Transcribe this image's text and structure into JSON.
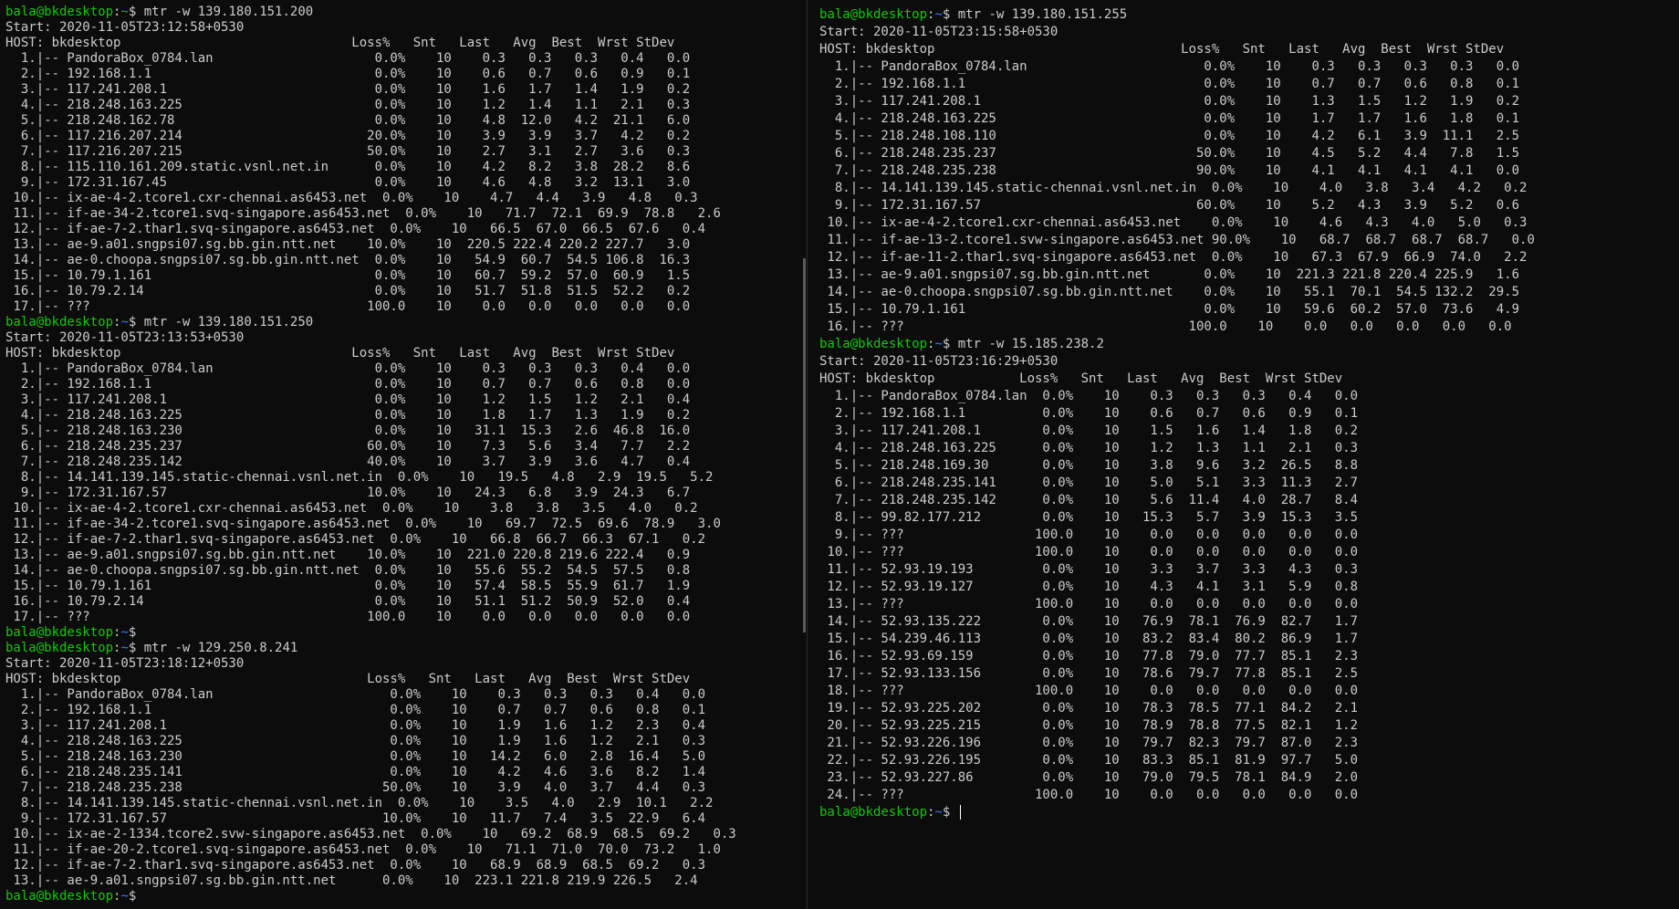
{
  "prompt": {
    "user": "bala@bkdesktop",
    "sep": ":",
    "path": "~",
    "sym": "$"
  },
  "cursor": " ",
  "left": {
    "lines": [
      {
        "t": "prompt",
        "cmd": " mtr -w 139.180.151.200"
      },
      {
        "t": "text",
        "text": "Start: 2020-11-05T23:12:58+0530"
      },
      {
        "t": "text",
        "text": "HOST: bkdesktop                              Loss%   Snt   Last   Avg  Best  Wrst StDev"
      },
      {
        "t": "text",
        "text": "  1.|-- PandoraBox_0784.lan                     0.0%    10    0.3   0.3   0.3   0.4   0.0"
      },
      {
        "t": "text",
        "text": "  2.|-- 192.168.1.1                             0.0%    10    0.6   0.7   0.6   0.9   0.1"
      },
      {
        "t": "text",
        "text": "  3.|-- 117.241.208.1                           0.0%    10    1.6   1.7   1.4   1.9   0.2"
      },
      {
        "t": "text",
        "text": "  4.|-- 218.248.163.225                         0.0%    10    1.2   1.4   1.1   2.1   0.3"
      },
      {
        "t": "text",
        "text": "  5.|-- 218.248.162.78                          0.0%    10    4.8  12.0   4.2  21.1   6.0"
      },
      {
        "t": "text",
        "text": "  6.|-- 117.216.207.214                        20.0%    10    3.9   3.9   3.7   4.2   0.2"
      },
      {
        "t": "text",
        "text": "  7.|-- 117.216.207.215                        50.0%    10    2.7   3.1   2.7   3.6   0.3"
      },
      {
        "t": "text",
        "text": "  8.|-- 115.110.161.209.static.vsnl.net.in      0.0%    10    4.2   8.2   3.8  28.2   8.6"
      },
      {
        "t": "text",
        "text": "  9.|-- 172.31.167.45                           0.0%    10    4.6   4.8   3.2  13.1   3.0"
      },
      {
        "t": "text",
        "text": " 10.|-- ix-ae-4-2.tcore1.cxr-chennai.as6453.net  0.0%    10    4.7   4.4   3.9   4.8   0.3"
      },
      {
        "t": "text",
        "text": " 11.|-- if-ae-34-2.tcore1.svq-singapore.as6453.net  0.0%    10   71.7  72.1  69.9  78.8   2.6"
      },
      {
        "t": "text",
        "text": " 12.|-- if-ae-7-2.thar1.svq-singapore.as6453.net  0.0%    10   66.5  67.0  66.5  67.6   0.4"
      },
      {
        "t": "text",
        "text": " 13.|-- ae-9.a01.sngpsi07.sg.bb.gin.ntt.net    10.0%    10  220.5 222.4 220.2 227.7   3.0"
      },
      {
        "t": "text",
        "text": " 14.|-- ae-0.choopa.sngpsi07.sg.bb.gin.ntt.net  0.0%    10   54.9  60.7  54.5 106.8  16.3"
      },
      {
        "t": "text",
        "text": " 15.|-- 10.79.1.161                             0.0%    10   60.7  59.2  57.0  60.9   1.5"
      },
      {
        "t": "text",
        "text": " 16.|-- 10.79.2.14                              0.0%    10   51.7  51.8  51.5  52.2   0.2"
      },
      {
        "t": "text",
        "text": " 17.|-- ???                                    100.0    10    0.0   0.0   0.0   0.0   0.0"
      },
      {
        "t": "prompt",
        "cmd": " mtr -w 139.180.151.250"
      },
      {
        "t": "text",
        "text": "Start: 2020-11-05T23:13:53+0530"
      },
      {
        "t": "text",
        "text": "HOST: bkdesktop                              Loss%   Snt   Last   Avg  Best  Wrst StDev"
      },
      {
        "t": "text",
        "text": "  1.|-- PandoraBox_0784.lan                     0.0%    10    0.3   0.3   0.3   0.4   0.0"
      },
      {
        "t": "text",
        "text": "  2.|-- 192.168.1.1                             0.0%    10    0.7   0.7   0.6   0.8   0.0"
      },
      {
        "t": "text",
        "text": "  3.|-- 117.241.208.1                           0.0%    10    1.2   1.5   1.2   2.1   0.4"
      },
      {
        "t": "text",
        "text": "  4.|-- 218.248.163.225                         0.0%    10    1.8   1.7   1.3   1.9   0.2"
      },
      {
        "t": "text",
        "text": "  5.|-- 218.248.163.230                         0.0%    10   31.1  15.3   2.6  46.8  16.0"
      },
      {
        "t": "text",
        "text": "  6.|-- 218.248.235.237                        60.0%    10    7.3   5.6   3.4   7.7   2.2"
      },
      {
        "t": "text",
        "text": "  7.|-- 218.248.235.142                        40.0%    10    3.7   3.9   3.6   4.7   0.4"
      },
      {
        "t": "text",
        "text": "  8.|-- 14.141.139.145.static-chennai.vsnl.net.in  0.0%    10   19.5   4.8   2.9  19.5   5.2"
      },
      {
        "t": "text",
        "text": "  9.|-- 172.31.167.57                          10.0%    10   24.3   6.8   3.9  24.3   6.7"
      },
      {
        "t": "text",
        "text": " 10.|-- ix-ae-4-2.tcore1.cxr-chennai.as6453.net  0.0%    10    3.8   3.8   3.5   4.0   0.2"
      },
      {
        "t": "text",
        "text": " 11.|-- if-ae-34-2.tcore1.svq-singapore.as6453.net  0.0%    10   69.7  72.5  69.6  78.9   3.0"
      },
      {
        "t": "text",
        "text": " 12.|-- if-ae-7-2.thar1.svq-singapore.as6453.net  0.0%    10   66.8  66.7  66.3  67.1   0.2"
      },
      {
        "t": "text",
        "text": " 13.|-- ae-9.a01.sngpsi07.sg.bb.gin.ntt.net    10.0%    10  221.0 220.8 219.6 222.4   0.9"
      },
      {
        "t": "text",
        "text": " 14.|-- ae-0.choopa.sngpsi07.sg.bb.gin.ntt.net  0.0%    10   55.6  55.2  54.5  57.5   0.8"
      },
      {
        "t": "text",
        "text": " 15.|-- 10.79.1.161                             0.0%    10   57.4  58.5  55.9  61.7   1.9"
      },
      {
        "t": "text",
        "text": " 16.|-- 10.79.2.14                              0.0%    10   51.1  51.2  50.9  52.0   0.4"
      },
      {
        "t": "text",
        "text": " 17.|-- ???                                    100.0    10    0.0   0.0   0.0   0.0   0.0"
      },
      {
        "t": "prompt",
        "cmd": ""
      },
      {
        "t": "prompt",
        "cmd": " mtr -w 129.250.8.241"
      },
      {
        "t": "text",
        "text": "Start: 2020-11-05T23:18:12+0530"
      },
      {
        "t": "text",
        "text": "HOST: bkdesktop                                Loss%   Snt   Last   Avg  Best  Wrst StDev"
      },
      {
        "t": "text",
        "text": "  1.|-- PandoraBox_0784.lan                       0.0%    10    0.3   0.3   0.3   0.4   0.0"
      },
      {
        "t": "text",
        "text": "  2.|-- 192.168.1.1                               0.0%    10    0.7   0.7   0.6   0.8   0.1"
      },
      {
        "t": "text",
        "text": "  3.|-- 117.241.208.1                             0.0%    10    1.9   1.6   1.2   2.3   0.4"
      },
      {
        "t": "text",
        "text": "  4.|-- 218.248.163.225                           0.0%    10    1.9   1.6   1.2   2.1   0.3"
      },
      {
        "t": "text",
        "text": "  5.|-- 218.248.163.230                           0.0%    10   14.2   6.0   2.8  16.4   5.0"
      },
      {
        "t": "text",
        "text": "  6.|-- 218.248.235.141                           0.0%    10    4.2   4.6   3.6   8.2   1.4"
      },
      {
        "t": "text",
        "text": "  7.|-- 218.248.235.238                          50.0%    10    3.9   4.0   3.7   4.4   0.3"
      },
      {
        "t": "text",
        "text": "  8.|-- 14.141.139.145.static-chennai.vsnl.net.in  0.0%    10    3.5   4.0   2.9  10.1   2.2"
      },
      {
        "t": "text",
        "text": "  9.|-- 172.31.167.57                            10.0%    10   11.7   7.4   3.5  22.9   6.4"
      },
      {
        "t": "text",
        "text": " 10.|-- ix-ae-2-1334.tcore2.svw-singapore.as6453.net  0.0%    10   69.2  68.9  68.5  69.2   0.3"
      },
      {
        "t": "text",
        "text": " 11.|-- if-ae-20-2.tcore1.svq-singapore.as6453.net  0.0%    10   71.1  71.0  70.0  73.2   1.0"
      },
      {
        "t": "text",
        "text": " 12.|-- if-ae-7-2.thar1.svq-singapore.as6453.net  0.0%    10   68.9  68.9  68.5  69.2   0.3"
      },
      {
        "t": "text",
        "text": " 13.|-- ae-9.a01.sngpsi07.sg.bb.gin.ntt.net      0.0%    10  223.1 221.8 219.9 226.5   2.4"
      },
      {
        "t": "prompt",
        "cmd": ""
      }
    ]
  },
  "right": {
    "lines": [
      {
        "t": "prompt",
        "cmd": " mtr -w 139.180.151.255"
      },
      {
        "t": "text",
        "text": "Start: 2020-11-05T23:15:58+0530"
      },
      {
        "t": "text",
        "text": "HOST: bkdesktop                                Loss%   Snt   Last   Avg  Best  Wrst StDev"
      },
      {
        "t": "text",
        "text": "  1.|-- PandoraBox_0784.lan                       0.0%    10    0.3   0.3   0.3   0.3   0.0"
      },
      {
        "t": "text",
        "text": "  2.|-- 192.168.1.1                               0.0%    10    0.7   0.7   0.6   0.8   0.1"
      },
      {
        "t": "text",
        "text": "  3.|-- 117.241.208.1                             0.0%    10    1.3   1.5   1.2   1.9   0.2"
      },
      {
        "t": "text",
        "text": "  4.|-- 218.248.163.225                           0.0%    10    1.7   1.7   1.6   1.8   0.1"
      },
      {
        "t": "text",
        "text": "  5.|-- 218.248.108.110                           0.0%    10    4.2   6.1   3.9  11.1   2.5"
      },
      {
        "t": "text",
        "text": "  6.|-- 218.248.235.237                          50.0%    10    4.5   5.2   4.4   7.8   1.5"
      },
      {
        "t": "text",
        "text": "  7.|-- 218.248.235.238                          90.0%    10    4.1   4.1   4.1   4.1   0.0"
      },
      {
        "t": "text",
        "text": "  8.|-- 14.141.139.145.static-chennai.vsnl.net.in  0.0%    10    4.0   3.8   3.4   4.2   0.2"
      },
      {
        "t": "text",
        "text": "  9.|-- 172.31.167.57                            60.0%    10    5.2   4.3   3.9   5.2   0.6"
      },
      {
        "t": "text",
        "text": " 10.|-- ix-ae-4-2.tcore1.cxr-chennai.as6453.net    0.0%    10    4.6   4.3   4.0   5.0   0.3"
      },
      {
        "t": "text",
        "text": " 11.|-- if-ae-13-2.tcore1.svw-singapore.as6453.net 90.0%    10   68.7  68.7  68.7  68.7   0.0"
      },
      {
        "t": "text",
        "text": " 12.|-- if-ae-11-2.thar1.svq-singapore.as6453.net  0.0%    10   67.3  67.9  66.9  74.0   2.2"
      },
      {
        "t": "text",
        "text": " 13.|-- ae-9.a01.sngpsi07.sg.bb.gin.ntt.net       0.0%    10  221.3 221.8 220.4 225.9   1.6"
      },
      {
        "t": "text",
        "text": " 14.|-- ae-0.choopa.sngpsi07.sg.bb.gin.ntt.net    0.0%    10   55.1  70.1  54.5 132.2  29.5"
      },
      {
        "t": "text",
        "text": " 15.|-- 10.79.1.161                               0.0%    10   59.6  60.2  57.0  73.6   4.9"
      },
      {
        "t": "text",
        "text": " 16.|-- ???                                     100.0    10    0.0   0.0   0.0   0.0   0.0"
      },
      {
        "t": "prompt",
        "cmd": " mtr -w 15.185.238.2"
      },
      {
        "t": "text",
        "text": "Start: 2020-11-05T23:16:29+0530"
      },
      {
        "t": "text",
        "text": "HOST: bkdesktop           Loss%   Snt   Last   Avg  Best  Wrst StDev"
      },
      {
        "t": "text",
        "text": "  1.|-- PandoraBox_0784.lan  0.0%    10    0.3   0.3   0.3   0.4   0.0"
      },
      {
        "t": "text",
        "text": "  2.|-- 192.168.1.1          0.0%    10    0.6   0.7   0.6   0.9   0.1"
      },
      {
        "t": "text",
        "text": "  3.|-- 117.241.208.1        0.0%    10    1.5   1.6   1.4   1.8   0.2"
      },
      {
        "t": "text",
        "text": "  4.|-- 218.248.163.225      0.0%    10    1.2   1.3   1.1   2.1   0.3"
      },
      {
        "t": "text",
        "text": "  5.|-- 218.248.169.30       0.0%    10    3.8   9.6   3.2  26.5   8.8"
      },
      {
        "t": "text",
        "text": "  6.|-- 218.248.235.141      0.0%    10    5.0   5.1   3.3  11.3   2.7"
      },
      {
        "t": "text",
        "text": "  7.|-- 218.248.235.142      0.0%    10    5.6  11.4   4.0  28.7   8.4"
      },
      {
        "t": "text",
        "text": "  8.|-- 99.82.177.212        0.0%    10   15.3   5.7   3.9  15.3   3.5"
      },
      {
        "t": "text",
        "text": "  9.|-- ???                 100.0    10    0.0   0.0   0.0   0.0   0.0"
      },
      {
        "t": "text",
        "text": " 10.|-- ???                 100.0    10    0.0   0.0   0.0   0.0   0.0"
      },
      {
        "t": "text",
        "text": " 11.|-- 52.93.19.193         0.0%    10    3.3   3.7   3.3   4.3   0.3"
      },
      {
        "t": "text",
        "text": " 12.|-- 52.93.19.127         0.0%    10    4.3   4.1   3.1   5.9   0.8"
      },
      {
        "t": "text",
        "text": " 13.|-- ???                 100.0    10    0.0   0.0   0.0   0.0   0.0"
      },
      {
        "t": "text",
        "text": " 14.|-- 52.93.135.222        0.0%    10   76.9  78.1  76.9  82.7   1.7"
      },
      {
        "t": "text",
        "text": " 15.|-- 54.239.46.113        0.0%    10   83.2  83.4  80.2  86.9   1.7"
      },
      {
        "t": "text",
        "text": " 16.|-- 52.93.69.159         0.0%    10   77.8  79.0  77.7  85.1   2.3"
      },
      {
        "t": "text",
        "text": " 17.|-- 52.93.133.156        0.0%    10   78.6  79.7  77.8  85.1   2.5"
      },
      {
        "t": "text",
        "text": " 18.|-- ???                 100.0    10    0.0   0.0   0.0   0.0   0.0"
      },
      {
        "t": "text",
        "text": " 19.|-- 52.93.225.202        0.0%    10   78.3  78.5  77.1  84.2   2.1"
      },
      {
        "t": "text",
        "text": " 20.|-- 52.93.225.215        0.0%    10   78.9  78.8  77.5  82.1   1.2"
      },
      {
        "t": "text",
        "text": " 21.|-- 52.93.226.196        0.0%    10   79.7  82.3  79.7  87.0   2.3"
      },
      {
        "t": "text",
        "text": " 22.|-- 52.93.226.195        0.0%    10   83.3  85.1  81.9  97.7   5.0"
      },
      {
        "t": "text",
        "text": " 23.|-- 52.93.227.86         0.0%    10   79.0  79.5  78.1  84.9   2.0"
      },
      {
        "t": "text",
        "text": " 24.|-- ???                 100.0    10    0.0   0.0   0.0   0.0   0.0"
      },
      {
        "t": "prompt",
        "cmd": " ",
        "cursor": true
      }
    ]
  },
  "colors": {
    "background": "#0c0c0c",
    "text": "#cccccc",
    "user": "#16c60c",
    "path": "#3b78ff"
  }
}
